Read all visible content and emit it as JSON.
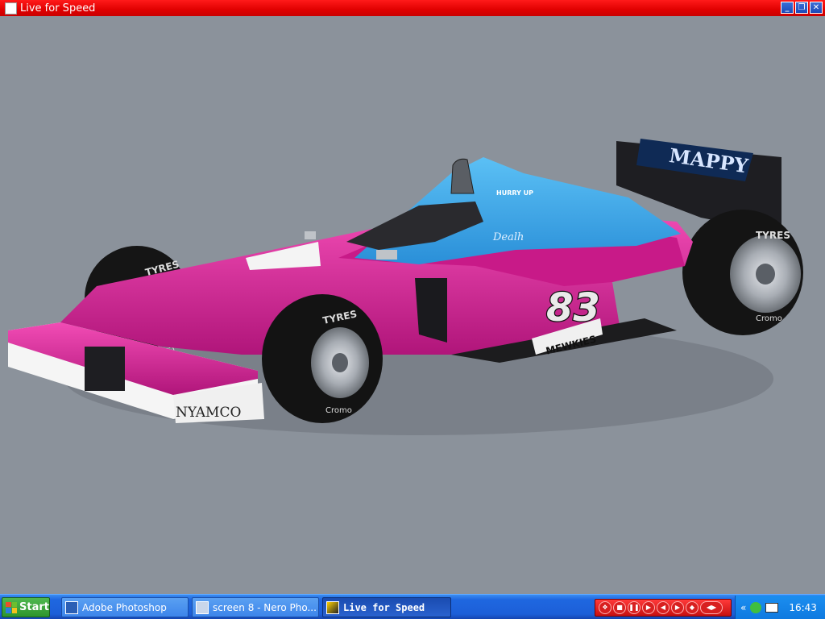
{
  "window": {
    "title": "Live for Speed"
  },
  "car": {
    "number": "83",
    "wing_sponsor": "MAPPY",
    "front_wing_sponsor": "NYAMCO",
    "sidepod_sponsor": "MEWKIES",
    "cockpit_text": "HURRY UP",
    "engine_cover_text": "Dealh",
    "tyre_brand": "TYRES",
    "tyre_sidewall": "Cromo",
    "colors": {
      "body_pink": "#e0209a",
      "cockpit_blue": "#3aa8e8",
      "tyre": "#141414",
      "rim": "#b8bcc2"
    }
  },
  "taskbar": {
    "start_label": "Start",
    "tasks": [
      {
        "label": "Adobe Photoshop",
        "icon": "photoshop-icon"
      },
      {
        "label": "screen 8 - Nero Pho...",
        "icon": "nero-photo-icon"
      },
      {
        "label": "Live for Speed",
        "icon": "lfs-icon"
      }
    ],
    "clock": "16:43"
  }
}
